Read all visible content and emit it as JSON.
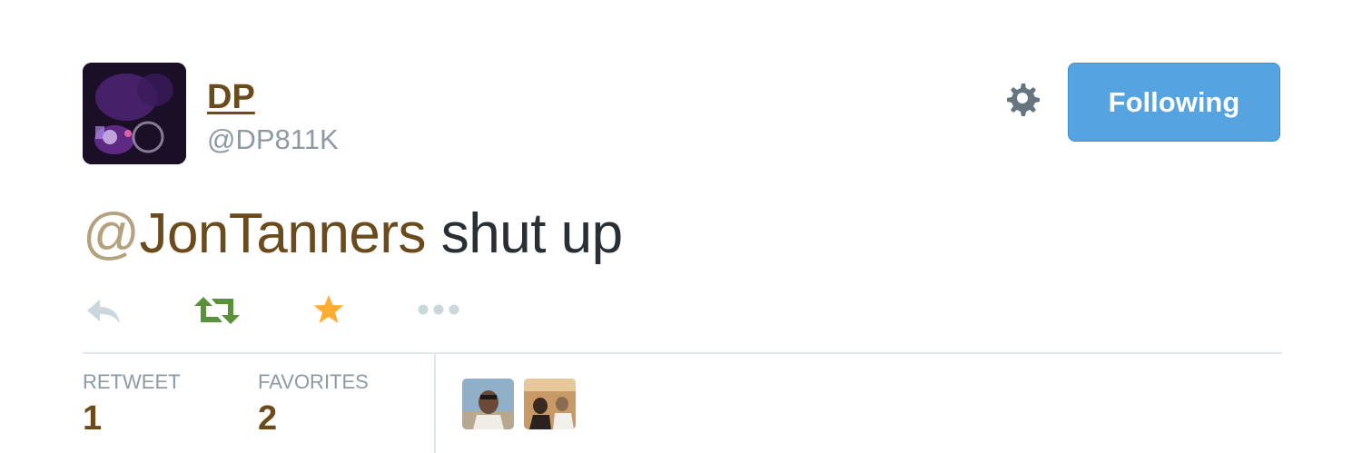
{
  "tweet": {
    "author": {
      "name": "DP",
      "handle": "@DP811K"
    },
    "follow_button_label": "Following",
    "text": {
      "mention_at": "@",
      "mention_name": "JonTanners",
      "body": " shut up"
    },
    "actions": [
      "reply-icon",
      "retweet-icon",
      "favorite-icon",
      "more-icon"
    ],
    "stats": {
      "retweet_label": "RETWEET",
      "retweet_count": "1",
      "favorites_label": "FAVORITES",
      "favorites_count": "2"
    },
    "colors": {
      "link": "#6b4b1c",
      "follow_button": "#55a4e1",
      "retweet_active": "#5c913b",
      "favorite_active": "#ffac33",
      "muted": "#8e99a3"
    }
  }
}
